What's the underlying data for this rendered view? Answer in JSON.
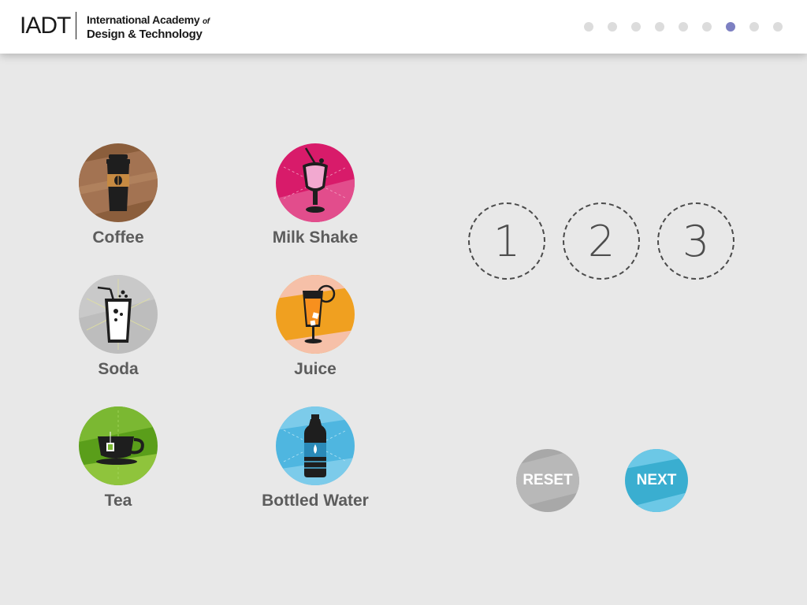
{
  "header": {
    "logo_mark": "IADT",
    "logo_line1": "International Academy",
    "logo_of": "of",
    "logo_line2": "Design & Technology",
    "page_dots": 9,
    "active_dot": 6
  },
  "drinks": [
    {
      "label": "Coffee",
      "icon": "coffee-cup-icon",
      "color": "#8b5e3c"
    },
    {
      "label": "Milk Shake",
      "icon": "milkshake-icon",
      "color": "#d81b6a"
    },
    {
      "label": "Soda",
      "icon": "soda-glass-icon",
      "color": "#b5b5b5"
    },
    {
      "label": "Juice",
      "icon": "juice-glass-icon",
      "color": "#f0a020"
    },
    {
      "label": "Tea",
      "icon": "tea-cup-icon",
      "color": "#5a9e1a"
    },
    {
      "label": "Bottled Water",
      "icon": "water-bottle-icon",
      "color": "#4fb6e0"
    }
  ],
  "rank_slots": [
    "1",
    "2",
    "3"
  ],
  "buttons": {
    "reset_label": "RESET",
    "next_label": "NEXT",
    "reset_color": "#a8a8a8",
    "next_color": "#3aaed0"
  },
  "colors": {
    "background": "#e8e8e8",
    "active_dot": "#7d80c2",
    "inactive_dot": "#dcdcdc"
  }
}
